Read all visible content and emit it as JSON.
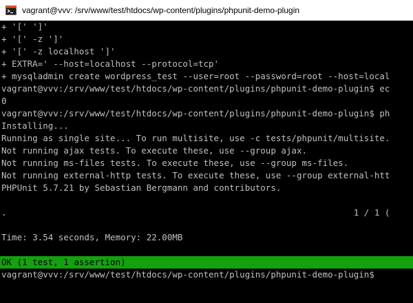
{
  "window": {
    "title": "vagrant@vvv: /srv/www/test/htdocs/wp-content/plugins/phpunit-demo-plugin",
    "icon": "terminal-icon"
  },
  "terminal": {
    "lines": [
      "+ '[' ']'",
      "+ '[' -z ']'",
      "+ '[' -z localhost ']'",
      "+ EXTRA=' --host=localhost --protocol=tcp'",
      "+ mysqladmin create wordpress_test --user=root --password=root --host=local",
      "vagrant@vvv:/srv/www/test/htdocs/wp-content/plugins/phpunit-demo-plugin$ ec",
      "0",
      "vagrant@vvv:/srv/www/test/htdocs/wp-content/plugins/phpunit-demo-plugin$ ph",
      "Installing...",
      "Running as single site... To run multisite, use -c tests/phpunit/multisite.",
      "Not running ajax tests. To execute these, use --group ajax.",
      "Not running ms-files tests. To execute these, use --group ms-files.",
      "Not running external-http tests. To execute these, use --group external-htt",
      "PHPUnit 5.7.21 by Sebastian Bergmann and contributors.",
      "",
      ".                                                                   1 / 1 (",
      "",
      "Time: 3.54 seconds, Memory: 22.00MB",
      "",
      "OK (1 test, 1 assertion)",
      "vagrant@vvv:/srv/www/test/htdocs/wp-content/plugins/phpunit-demo-plugin$"
    ]
  },
  "colors": {
    "background": "#000000",
    "foreground": "#c0c0c0",
    "pass_background": "#13a10e"
  }
}
